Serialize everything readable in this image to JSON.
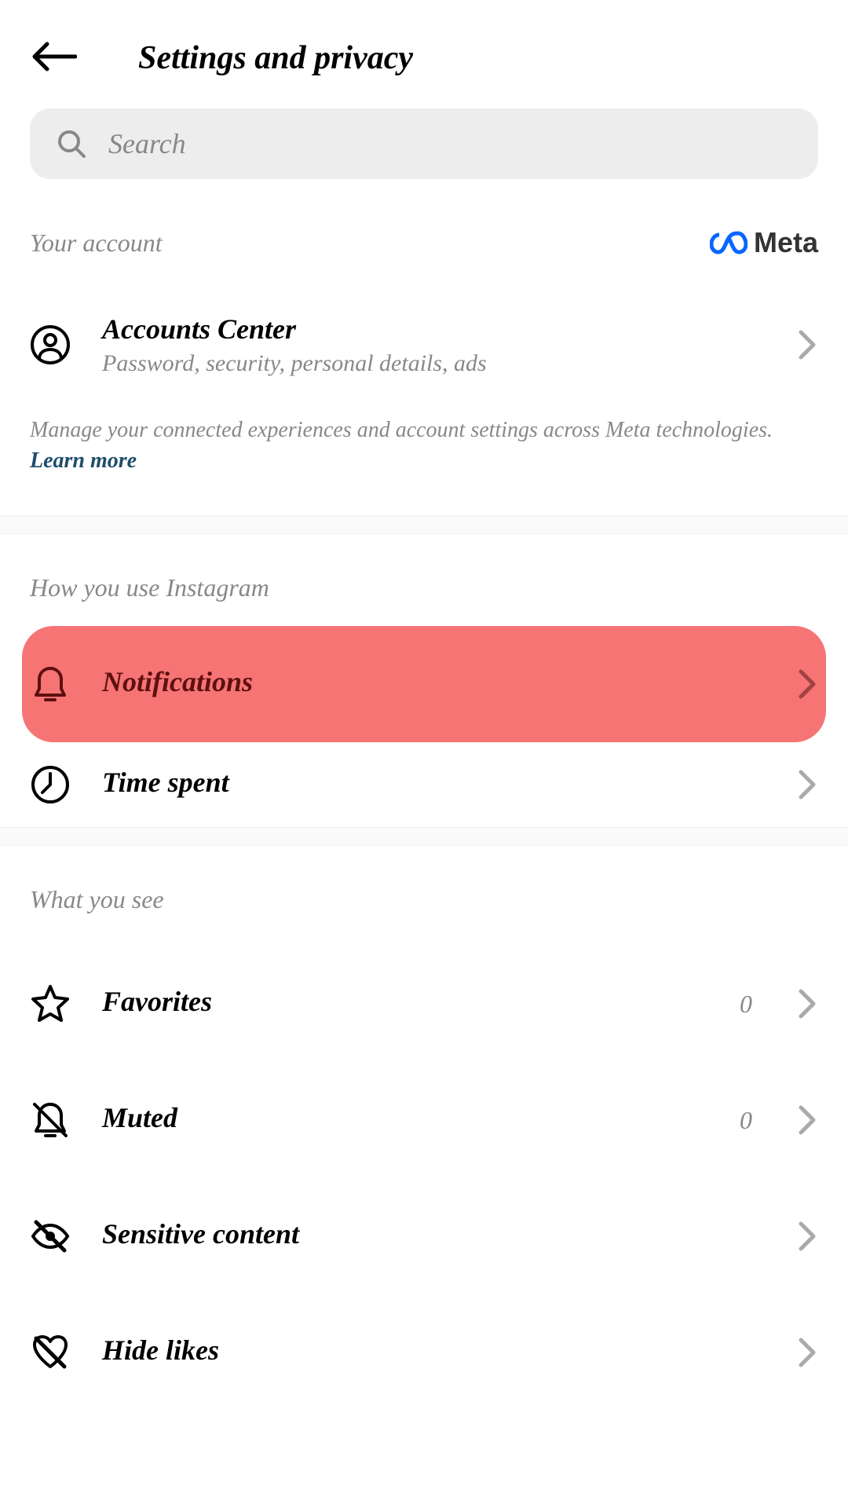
{
  "header": {
    "title": "Settings and privacy"
  },
  "search": {
    "placeholder": "Search"
  },
  "account_section": {
    "label": "Your account",
    "meta_label": "Meta",
    "accounts_center": {
      "title": "Accounts Center",
      "subtitle": "Password, security, personal details, ads"
    },
    "description": "Manage your connected experiences and account settings across Meta technologies. ",
    "learn_more": "Learn more"
  },
  "usage_section": {
    "label": "How you use Instagram",
    "items": [
      {
        "label": "Notifications"
      },
      {
        "label": "Time spent"
      }
    ]
  },
  "see_section": {
    "label": "What you see",
    "items": [
      {
        "label": "Favorites",
        "count": "0"
      },
      {
        "label": "Muted",
        "count": "0"
      },
      {
        "label": "Sensitive content"
      },
      {
        "label": "Hide likes"
      }
    ]
  }
}
